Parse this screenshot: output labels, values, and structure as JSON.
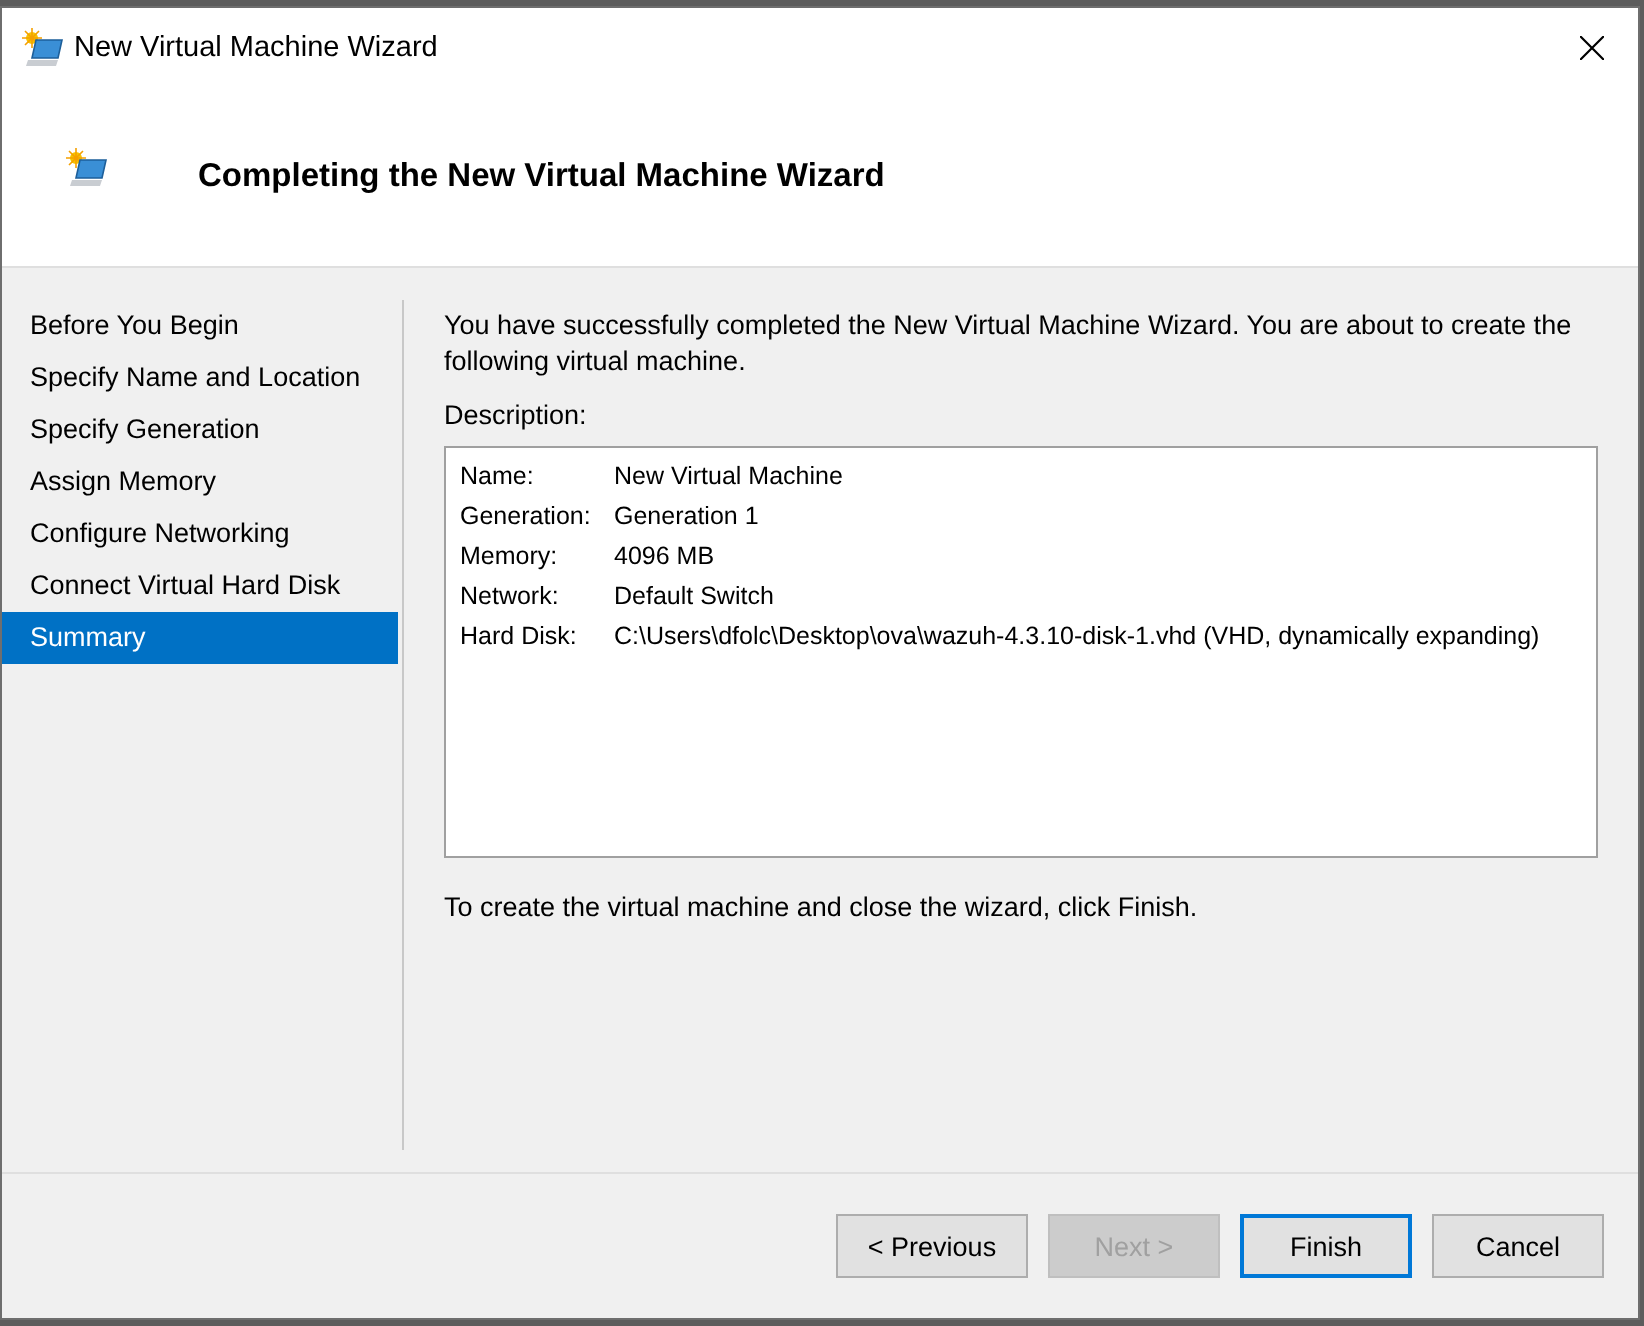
{
  "window": {
    "title": "New Virtual Machine Wizard"
  },
  "header": {
    "title": "Completing the New Virtual Machine Wizard"
  },
  "steps": [
    {
      "label": "Before You Begin",
      "selected": false
    },
    {
      "label": "Specify Name and Location",
      "selected": false
    },
    {
      "label": "Specify Generation",
      "selected": false
    },
    {
      "label": "Assign Memory",
      "selected": false
    },
    {
      "label": "Configure Networking",
      "selected": false
    },
    {
      "label": "Connect Virtual Hard Disk",
      "selected": false
    },
    {
      "label": "Summary",
      "selected": true
    }
  ],
  "intro": "You have successfully completed the New Virtual Machine Wizard. You are about to create the following virtual machine.",
  "description": {
    "label": "Description:",
    "rows": [
      {
        "key": "Name:",
        "value": "New Virtual Machine"
      },
      {
        "key": "Generation:",
        "value": "Generation 1"
      },
      {
        "key": "Memory:",
        "value": "4096 MB"
      },
      {
        "key": "Network:",
        "value": "Default Switch"
      },
      {
        "key": "Hard Disk:",
        "value": "C:\\Users\\dfolc\\Desktop\\ova\\wazuh-4.3.10-disk-1.vhd (VHD, dynamically expanding)"
      }
    ]
  },
  "footer_note": "To create the virtual machine and close the wizard, click Finish.",
  "buttons": [
    {
      "label": "< Previous",
      "disabled": false,
      "default": false
    },
    {
      "label": "Next >",
      "disabled": true,
      "default": false
    },
    {
      "label": "Finish",
      "disabled": false,
      "default": true
    },
    {
      "label": "Cancel",
      "disabled": false,
      "default": false
    }
  ]
}
